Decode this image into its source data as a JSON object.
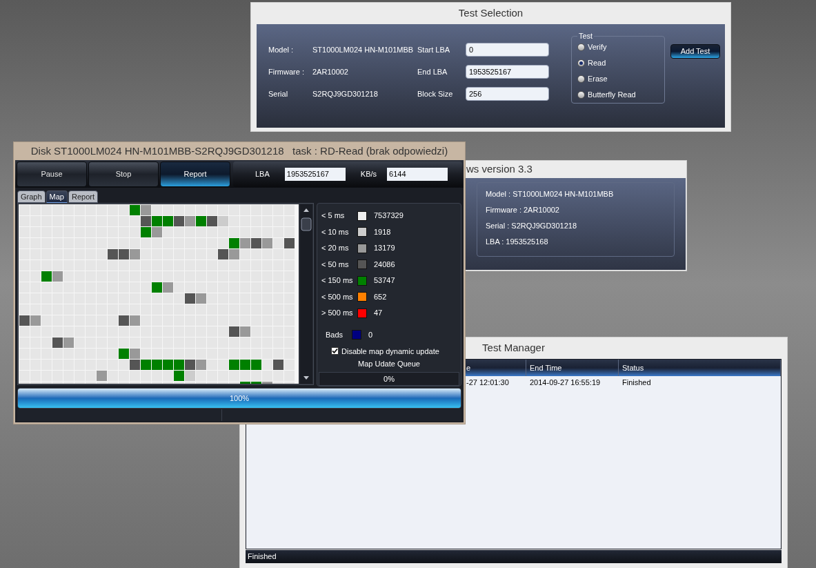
{
  "test_selection": {
    "title": "Test Selection",
    "drive": [
      {
        "label": "Model :",
        "value": "ST1000LM024 HN-M101MBB"
      },
      {
        "label": "Firmware :",
        "value": "2AR10002"
      },
      {
        "label": "Serial",
        "value": "S2RQJ9GD301218"
      }
    ],
    "fields": [
      {
        "label": "Start LBA",
        "value": "0"
      },
      {
        "label": "End LBA",
        "value": "1953525167"
      },
      {
        "label": "Block Size",
        "value": "256"
      }
    ],
    "test_group": {
      "title": "Test",
      "options": [
        {
          "label": "Verify",
          "selected": false
        },
        {
          "label": "Read",
          "selected": true
        },
        {
          "label": "Erase",
          "selected": false
        },
        {
          "label": "Butterfly Read",
          "selected": false
        }
      ]
    },
    "add_button": "Add Test"
  },
  "info_window": {
    "title": "ws version 3.3",
    "lines": [
      "Model : ST1000LM024 HN-M101MBB",
      "Firmware : 2AR10002",
      "Serial : S2RQJ9GD301218",
      "LBA : 1953525168"
    ]
  },
  "test_manager": {
    "title": "Test Manager",
    "columns": [
      "e",
      "End Time",
      "Status"
    ],
    "rows": [
      [
        "-27 12:01:30",
        "2014-09-27 16:55:19",
        "Finished"
      ]
    ],
    "status": "Finished"
  },
  "disk_window": {
    "title": "Disk ST1000LM024 HN-M101MBB-S2RQJ9GD301218   task : RD-Read (brak odpowiedzi)",
    "buttons": [
      {
        "label": "Pause",
        "highlighted": false
      },
      {
        "label": "Stop",
        "highlighted": false
      },
      {
        "label": "Report",
        "highlighted": true
      }
    ],
    "lba": {
      "label": "LBA",
      "value": "1953525167"
    },
    "speed": {
      "label": "KB/s",
      "value": "6144"
    },
    "tabs": [
      {
        "label": "Graph",
        "selected": false
      },
      {
        "label": "Map",
        "selected": true
      },
      {
        "label": "Report",
        "selected": false
      }
    ],
    "map": {
      "rows": [
        [
          {
            "kind": "k5"
          },
          {
            "kind": "k5"
          },
          {
            "kind": "k5"
          },
          {
            "kind": "k5"
          },
          {
            "kind": "k5"
          },
          {
            "kind": "k5"
          },
          {
            "kind": "k5"
          },
          {
            "kind": "k5"
          },
          {
            "kind": "k5"
          },
          {
            "kind": "k5"
          },
          {
            "kind": "k150"
          },
          {
            "kind": "k20"
          },
          {
            "kind": "k5"
          },
          {
            "kind": "k5"
          },
          {
            "kind": "k5"
          },
          {
            "kind": "k5"
          },
          {
            "kind": "k5"
          },
          {
            "kind": "k5"
          },
          {
            "kind": "k5"
          },
          {
            "kind": "k5"
          },
          {
            "kind": "k5"
          },
          {
            "kind": "k5"
          },
          {
            "kind": "k5"
          },
          {
            "kind": "k5"
          },
          {
            "kind": "k5"
          }
        ],
        [
          {
            "kind": "k5"
          },
          {
            "kind": "k5"
          },
          {
            "kind": "k5"
          },
          {
            "kind": "k5"
          },
          {
            "kind": "k5"
          },
          {
            "kind": "k5"
          },
          {
            "kind": "k5"
          },
          {
            "kind": "k5"
          },
          {
            "kind": "k5"
          },
          {
            "kind": "k5"
          },
          {
            "kind": "k5"
          },
          {
            "kind": "k50"
          },
          {
            "kind": "k150"
          },
          {
            "kind": "k150"
          },
          {
            "kind": "k50"
          },
          {
            "kind": "k20"
          },
          {
            "kind": "k150"
          },
          {
            "kind": "k50"
          },
          {
            "kind": "k10"
          },
          {
            "kind": "k5"
          },
          {
            "kind": "k5"
          },
          {
            "kind": "k5"
          },
          {
            "kind": "k5"
          },
          {
            "kind": "k5"
          },
          {
            "kind": "k5"
          }
        ],
        [
          {
            "kind": "k5"
          },
          {
            "kind": "k5"
          },
          {
            "kind": "k5"
          },
          {
            "kind": "k5"
          },
          {
            "kind": "k5"
          },
          {
            "kind": "k5"
          },
          {
            "kind": "k5"
          },
          {
            "kind": "k5"
          },
          {
            "kind": "k5"
          },
          {
            "kind": "k5"
          },
          {
            "kind": "k5"
          },
          {
            "kind": "k150"
          },
          {
            "kind": "k20"
          },
          {
            "kind": "k5"
          },
          {
            "kind": "k5"
          },
          {
            "kind": "k5"
          },
          {
            "kind": "k5"
          },
          {
            "kind": "k5"
          },
          {
            "kind": "k5"
          },
          {
            "kind": "k5"
          },
          {
            "kind": "k5"
          },
          {
            "kind": "k5"
          },
          {
            "kind": "k5"
          },
          {
            "kind": "k5"
          },
          {
            "kind": "k5"
          }
        ],
        [
          {
            "kind": "k5"
          },
          {
            "kind": "k5"
          },
          {
            "kind": "k5"
          },
          {
            "kind": "k5"
          },
          {
            "kind": "k5"
          },
          {
            "kind": "k5"
          },
          {
            "kind": "k5"
          },
          {
            "kind": "k5"
          },
          {
            "kind": "k5"
          },
          {
            "kind": "k5"
          },
          {
            "kind": "k5"
          },
          {
            "kind": "k5"
          },
          {
            "kind": "k5"
          },
          {
            "kind": "k5"
          },
          {
            "kind": "k5"
          },
          {
            "kind": "k5"
          },
          {
            "kind": "k5"
          },
          {
            "kind": "k5"
          },
          {
            "kind": "k5"
          },
          {
            "kind": "k150"
          },
          {
            "kind": "k20"
          },
          {
            "kind": "k50"
          },
          {
            "kind": "k20"
          },
          {
            "kind": "k5"
          },
          {
            "kind": "k50"
          }
        ],
        [
          {
            "kind": "k5"
          },
          {
            "kind": "k5"
          },
          {
            "kind": "k5"
          },
          {
            "kind": "k5"
          },
          {
            "kind": "k5"
          },
          {
            "kind": "k5"
          },
          {
            "kind": "k5"
          },
          {
            "kind": "k5"
          },
          {
            "kind": "k50"
          },
          {
            "kind": "k50"
          },
          {
            "kind": "k20"
          },
          {
            "kind": "k5"
          },
          {
            "kind": "k5"
          },
          {
            "kind": "k5"
          },
          {
            "kind": "k5"
          },
          {
            "kind": "k5"
          },
          {
            "kind": "k5"
          },
          {
            "kind": "k5"
          },
          {
            "kind": "k50"
          },
          {
            "kind": "k20"
          },
          {
            "kind": "k5"
          },
          {
            "kind": "k5"
          },
          {
            "kind": "k5"
          },
          {
            "kind": "k5"
          },
          {
            "kind": "k5"
          }
        ],
        [
          {
            "kind": "k5"
          },
          {
            "kind": "k5"
          },
          {
            "kind": "k5"
          },
          {
            "kind": "k5"
          },
          {
            "kind": "k5"
          },
          {
            "kind": "k5"
          },
          {
            "kind": "k5"
          },
          {
            "kind": "k5"
          },
          {
            "kind": "k5"
          },
          {
            "kind": "k5"
          },
          {
            "kind": "k5"
          },
          {
            "kind": "k5"
          },
          {
            "kind": "k5"
          },
          {
            "kind": "k5"
          },
          {
            "kind": "k5"
          },
          {
            "kind": "k5"
          },
          {
            "kind": "k5"
          },
          {
            "kind": "k5"
          },
          {
            "kind": "k5"
          },
          {
            "kind": "k5"
          },
          {
            "kind": "k5"
          },
          {
            "kind": "k5"
          },
          {
            "kind": "k5"
          },
          {
            "kind": "k5"
          },
          {
            "kind": "k5"
          }
        ],
        [
          {
            "kind": "k5"
          },
          {
            "kind": "k5"
          },
          {
            "kind": "k150"
          },
          {
            "kind": "k20"
          },
          {
            "kind": "k5"
          },
          {
            "kind": "k5"
          },
          {
            "kind": "k5"
          },
          {
            "kind": "k5"
          },
          {
            "kind": "k5"
          },
          {
            "kind": "k5"
          },
          {
            "kind": "k5"
          },
          {
            "kind": "k5"
          },
          {
            "kind": "k5"
          },
          {
            "kind": "k5"
          },
          {
            "kind": "k5"
          },
          {
            "kind": "k5"
          },
          {
            "kind": "k5"
          },
          {
            "kind": "k5"
          },
          {
            "kind": "k5"
          },
          {
            "kind": "k5"
          },
          {
            "kind": "k5"
          },
          {
            "kind": "k5"
          },
          {
            "kind": "k5"
          },
          {
            "kind": "k5"
          },
          {
            "kind": "k5"
          }
        ],
        [
          {
            "kind": "k5"
          },
          {
            "kind": "k5"
          },
          {
            "kind": "k5"
          },
          {
            "kind": "k5"
          },
          {
            "kind": "k5"
          },
          {
            "kind": "k5"
          },
          {
            "kind": "k5"
          },
          {
            "kind": "k5"
          },
          {
            "kind": "k5"
          },
          {
            "kind": "k5"
          },
          {
            "kind": "k5"
          },
          {
            "kind": "k5"
          },
          {
            "kind": "k150"
          },
          {
            "kind": "k20"
          },
          {
            "kind": "k5"
          },
          {
            "kind": "k5"
          },
          {
            "kind": "k5"
          },
          {
            "kind": "k5"
          },
          {
            "kind": "k5"
          },
          {
            "kind": "k5"
          },
          {
            "kind": "k5"
          },
          {
            "kind": "k5"
          },
          {
            "kind": "k5"
          },
          {
            "kind": "k5"
          },
          {
            "kind": "k5"
          }
        ],
        [
          {
            "kind": "k5"
          },
          {
            "kind": "k5"
          },
          {
            "kind": "k5"
          },
          {
            "kind": "k5"
          },
          {
            "kind": "k5"
          },
          {
            "kind": "k5"
          },
          {
            "kind": "k5"
          },
          {
            "kind": "k5"
          },
          {
            "kind": "k5"
          },
          {
            "kind": "k5"
          },
          {
            "kind": "k5"
          },
          {
            "kind": "k5"
          },
          {
            "kind": "k5"
          },
          {
            "kind": "k5"
          },
          {
            "kind": "k5"
          },
          {
            "kind": "k50"
          },
          {
            "kind": "k20"
          },
          {
            "kind": "k5"
          },
          {
            "kind": "k5"
          },
          {
            "kind": "k5"
          },
          {
            "kind": "k5"
          },
          {
            "kind": "k5"
          },
          {
            "kind": "k5"
          },
          {
            "kind": "k5"
          },
          {
            "kind": "k5"
          }
        ],
        [
          {
            "kind": "k5"
          },
          {
            "kind": "k5"
          },
          {
            "kind": "k5"
          },
          {
            "kind": "k5"
          },
          {
            "kind": "k5"
          },
          {
            "kind": "k5"
          },
          {
            "kind": "k5"
          },
          {
            "kind": "k5"
          },
          {
            "kind": "k5"
          },
          {
            "kind": "k5"
          },
          {
            "kind": "k5"
          },
          {
            "kind": "k5"
          },
          {
            "kind": "k5"
          },
          {
            "kind": "k5"
          },
          {
            "kind": "k5"
          },
          {
            "kind": "k5"
          },
          {
            "kind": "k5"
          },
          {
            "kind": "k5"
          },
          {
            "kind": "k5"
          },
          {
            "kind": "k5"
          },
          {
            "kind": "k5"
          },
          {
            "kind": "k5"
          },
          {
            "kind": "k5"
          },
          {
            "kind": "k5"
          },
          {
            "kind": "k5"
          }
        ],
        [
          {
            "kind": "k50"
          },
          {
            "kind": "k20"
          },
          {
            "kind": "k5"
          },
          {
            "kind": "k5"
          },
          {
            "kind": "k5"
          },
          {
            "kind": "k5"
          },
          {
            "kind": "k5"
          },
          {
            "kind": "k5"
          },
          {
            "kind": "k5"
          },
          {
            "kind": "k50"
          },
          {
            "kind": "k20"
          },
          {
            "kind": "k5"
          },
          {
            "kind": "k5"
          },
          {
            "kind": "k5"
          },
          {
            "kind": "k5"
          },
          {
            "kind": "k5"
          },
          {
            "kind": "k5"
          },
          {
            "kind": "k5"
          },
          {
            "kind": "k5"
          },
          {
            "kind": "k5"
          },
          {
            "kind": "k5"
          },
          {
            "kind": "k5"
          },
          {
            "kind": "k5"
          },
          {
            "kind": "k5"
          },
          {
            "kind": "k5"
          }
        ],
        [
          {
            "kind": "k5"
          },
          {
            "kind": "k5"
          },
          {
            "kind": "k5"
          },
          {
            "kind": "k5"
          },
          {
            "kind": "k5"
          },
          {
            "kind": "k5"
          },
          {
            "kind": "k5"
          },
          {
            "kind": "k5"
          },
          {
            "kind": "k5"
          },
          {
            "kind": "k5"
          },
          {
            "kind": "k5"
          },
          {
            "kind": "k5"
          },
          {
            "kind": "k5"
          },
          {
            "kind": "k5"
          },
          {
            "kind": "k5"
          },
          {
            "kind": "k5"
          },
          {
            "kind": "k5"
          },
          {
            "kind": "k5"
          },
          {
            "kind": "k5"
          },
          {
            "kind": "k50"
          },
          {
            "kind": "k20"
          },
          {
            "kind": "k5"
          },
          {
            "kind": "k5"
          },
          {
            "kind": "k5"
          },
          {
            "kind": "k5"
          }
        ],
        [
          {
            "kind": "k5"
          },
          {
            "kind": "k5"
          },
          {
            "kind": "k5"
          },
          {
            "kind": "k50"
          },
          {
            "kind": "k20"
          },
          {
            "kind": "k5"
          },
          {
            "kind": "k5"
          },
          {
            "kind": "k5"
          },
          {
            "kind": "k5"
          },
          {
            "kind": "k5"
          },
          {
            "kind": "k5"
          },
          {
            "kind": "k5"
          },
          {
            "kind": "k5"
          },
          {
            "kind": "k5"
          },
          {
            "kind": "k5"
          },
          {
            "kind": "k5"
          },
          {
            "kind": "k5"
          },
          {
            "kind": "k5"
          },
          {
            "kind": "k5"
          },
          {
            "kind": "k5"
          },
          {
            "kind": "k5"
          },
          {
            "kind": "k5"
          },
          {
            "kind": "k5"
          },
          {
            "kind": "k5"
          },
          {
            "kind": "k5"
          }
        ],
        [
          {
            "kind": "k5"
          },
          {
            "kind": "k5"
          },
          {
            "kind": "k5"
          },
          {
            "kind": "k5"
          },
          {
            "kind": "k5"
          },
          {
            "kind": "k5"
          },
          {
            "kind": "k5"
          },
          {
            "kind": "k5"
          },
          {
            "kind": "k5"
          },
          {
            "kind": "k150"
          },
          {
            "kind": "k20"
          },
          {
            "kind": "k5"
          },
          {
            "kind": "k5"
          },
          {
            "kind": "k5"
          },
          {
            "kind": "k5"
          },
          {
            "kind": "k5"
          },
          {
            "kind": "k5"
          },
          {
            "kind": "k5"
          },
          {
            "kind": "k5"
          },
          {
            "kind": "k5"
          },
          {
            "kind": "k5"
          },
          {
            "kind": "k5"
          },
          {
            "kind": "k5"
          },
          {
            "kind": "k5"
          },
          {
            "kind": "k5"
          }
        ],
        [
          {
            "kind": "k5"
          },
          {
            "kind": "k5"
          },
          {
            "kind": "k5"
          },
          {
            "kind": "k5"
          },
          {
            "kind": "k5"
          },
          {
            "kind": "k5"
          },
          {
            "kind": "k5"
          },
          {
            "kind": "k5"
          },
          {
            "kind": "k5"
          },
          {
            "kind": "k5"
          },
          {
            "kind": "k50"
          },
          {
            "kind": "k150"
          },
          {
            "kind": "k150"
          },
          {
            "kind": "k150"
          },
          {
            "kind": "k150"
          },
          {
            "kind": "k50"
          },
          {
            "kind": "k20"
          },
          {
            "kind": "k5"
          },
          {
            "kind": "k5"
          },
          {
            "kind": "k150"
          },
          {
            "kind": "k150"
          },
          {
            "kind": "k150"
          },
          {
            "kind": "k5"
          },
          {
            "kind": "k50"
          },
          {
            "kind": "k5"
          }
        ],
        [
          {
            "kind": "k5"
          },
          {
            "kind": "k5"
          },
          {
            "kind": "k5"
          },
          {
            "kind": "k5"
          },
          {
            "kind": "k5"
          },
          {
            "kind": "k5"
          },
          {
            "kind": "k5"
          },
          {
            "kind": "k20"
          },
          {
            "kind": "k5"
          },
          {
            "kind": "k5"
          },
          {
            "kind": "k5"
          },
          {
            "kind": "k5"
          },
          {
            "kind": "k5"
          },
          {
            "kind": "k5"
          },
          {
            "kind": "k150"
          },
          {
            "kind": "k10"
          },
          {
            "kind": "k5"
          },
          {
            "kind": "k5"
          },
          {
            "kind": "k5"
          },
          {
            "kind": "k5"
          },
          {
            "kind": "k5"
          },
          {
            "kind": "k5"
          },
          {
            "kind": "k5"
          },
          {
            "kind": "k5"
          },
          {
            "kind": "k5"
          }
        ],
        [
          {
            "kind": "k5"
          },
          {
            "kind": "k5"
          },
          {
            "kind": "k5"
          },
          {
            "kind": "k5"
          },
          {
            "kind": "k5"
          },
          {
            "kind": "k5"
          },
          {
            "kind": "k5"
          },
          {
            "kind": "k5"
          },
          {
            "kind": "k5"
          },
          {
            "kind": "k5"
          },
          {
            "kind": "k5"
          },
          {
            "kind": "k5"
          },
          {
            "kind": "k5"
          },
          {
            "kind": "k5"
          },
          {
            "kind": "k5"
          },
          {
            "kind": "k5"
          },
          {
            "kind": "k5"
          },
          {
            "kind": "k5"
          },
          {
            "kind": "k5"
          },
          {
            "kind": "k5"
          },
          {
            "kind": "k150"
          },
          {
            "kind": "k150"
          },
          {
            "kind": "k20"
          },
          {
            "kind": "k5"
          },
          {
            "kind": "k5"
          }
        ]
      ]
    },
    "legend": [
      {
        "label": "< 5 ms",
        "kind": "k5",
        "color": "#eeeeee",
        "count": "7537329"
      },
      {
        "label": "< 10 ms",
        "kind": "k10",
        "color": "#cccccc",
        "count": "1918"
      },
      {
        "label": "< 20 ms",
        "kind": "k20",
        "color": "#999999",
        "count": "13179"
      },
      {
        "label": "< 50 ms",
        "kind": "k50",
        "color": "#555555",
        "count": "24086"
      },
      {
        "label": "< 150 ms",
        "kind": "k150",
        "color": "#008000",
        "count": "53747"
      },
      {
        "label": "< 500 ms",
        "kind": "k500",
        "color": "#ff8000",
        "count": "652"
      },
      {
        "label": "> 500 ms",
        "kind": "kmax",
        "color": "#ff0000",
        "count": "47"
      },
      {
        "label": "Bads",
        "kind": "bads",
        "color": "#000080",
        "count": "0"
      }
    ],
    "dynamic_update": {
      "label": "Disable map dynamic update",
      "checked": true
    },
    "queue": {
      "label": "Map Udate Queue",
      "text": "0%",
      "level": 0
    },
    "progress": {
      "text": "100%",
      "level": 1
    }
  }
}
